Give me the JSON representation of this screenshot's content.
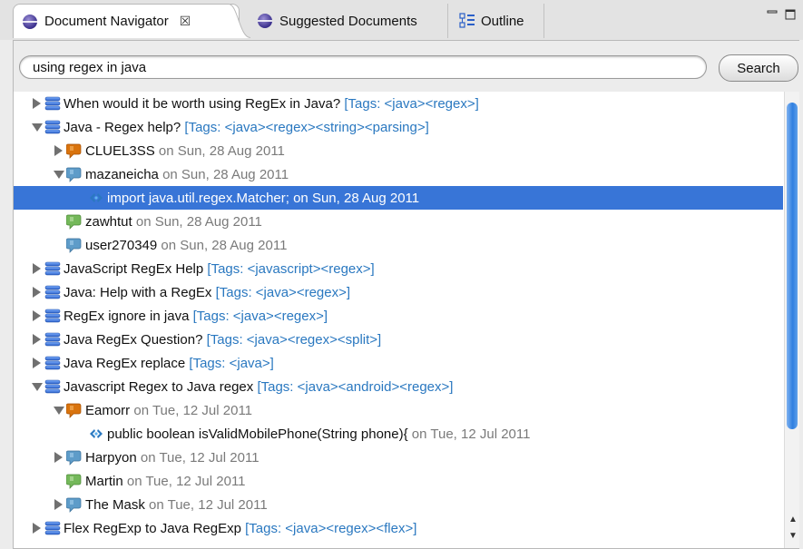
{
  "tabs": {
    "nav": {
      "label": "Document Navigator",
      "close": "☒"
    },
    "suggested": {
      "label": "Suggested Documents"
    },
    "outline": {
      "label": "Outline"
    }
  },
  "search": {
    "value": "using regex in java",
    "button": "Search"
  },
  "colors": {
    "selection": "#3875d7",
    "tags": "#2a78c0",
    "meta": "#7a7a7a"
  },
  "tree": {
    "r0": {
      "title": "When would it be worth using RegEx in Java?",
      "tags": "[Tags: <java><regex>]"
    },
    "r1": {
      "title": "Java - Regex help?",
      "tags": "[Tags: <java><regex><string><parsing>]"
    },
    "r2": {
      "author": "CLUEL3SS",
      "meta": "on Sun, 28 Aug 2011"
    },
    "r3": {
      "author": "mazaneicha",
      "meta": "on Sun, 28 Aug 2011"
    },
    "r4": {
      "code": "import java.util.regex.Matcher;",
      "meta": "on Sun, 28 Aug 2011"
    },
    "r5": {
      "author": "zawhtut",
      "meta": "on Sun, 28 Aug 2011"
    },
    "r6": {
      "author": "user270349",
      "meta": "on Sun, 28 Aug 2011"
    },
    "r7": {
      "title": "JavaScript RegEx Help",
      "tags": "[Tags: <javascript><regex>]"
    },
    "r8": {
      "title": "Java: Help with a RegEx",
      "tags": "[Tags: <java><regex>]"
    },
    "r9": {
      "title": "RegEx ignore in java",
      "tags": "[Tags: <java><regex>]"
    },
    "r10": {
      "title": "Java RegEx Question?",
      "tags": "[Tags: <java><regex><split>]"
    },
    "r11": {
      "title": "Java RegEx replace",
      "tags": "[Tags: <java>]"
    },
    "r12": {
      "title": "Javascript Regex to Java regex",
      "tags": "[Tags: <java><android><regex>]"
    },
    "r13": {
      "author": "Eamorr",
      "meta": "on Tue, 12 Jul 2011"
    },
    "r14": {
      "code": "public boolean isValidMobilePhone(String phone){",
      "meta": "on Tue, 12 Jul 2011"
    },
    "r15": {
      "author": "Harpyon",
      "meta": "on Tue, 12 Jul 2011"
    },
    "r16": {
      "author": "Martin",
      "meta": "on Tue, 12 Jul 2011"
    },
    "r17": {
      "author": "The Mask",
      "meta": "on Tue, 12 Jul 2011"
    },
    "r18": {
      "title": "Flex RegExp to Java RegExp",
      "tags": "[Tags: <java><regex><flex>]"
    }
  },
  "icons": {
    "question": "question-stack-icon",
    "answer_orange": "answer-bubble-orange-icon",
    "answer_blue": "answer-bubble-blue-icon",
    "answer_green": "answer-bubble-green-icon",
    "code": "code-snippet-icon"
  }
}
